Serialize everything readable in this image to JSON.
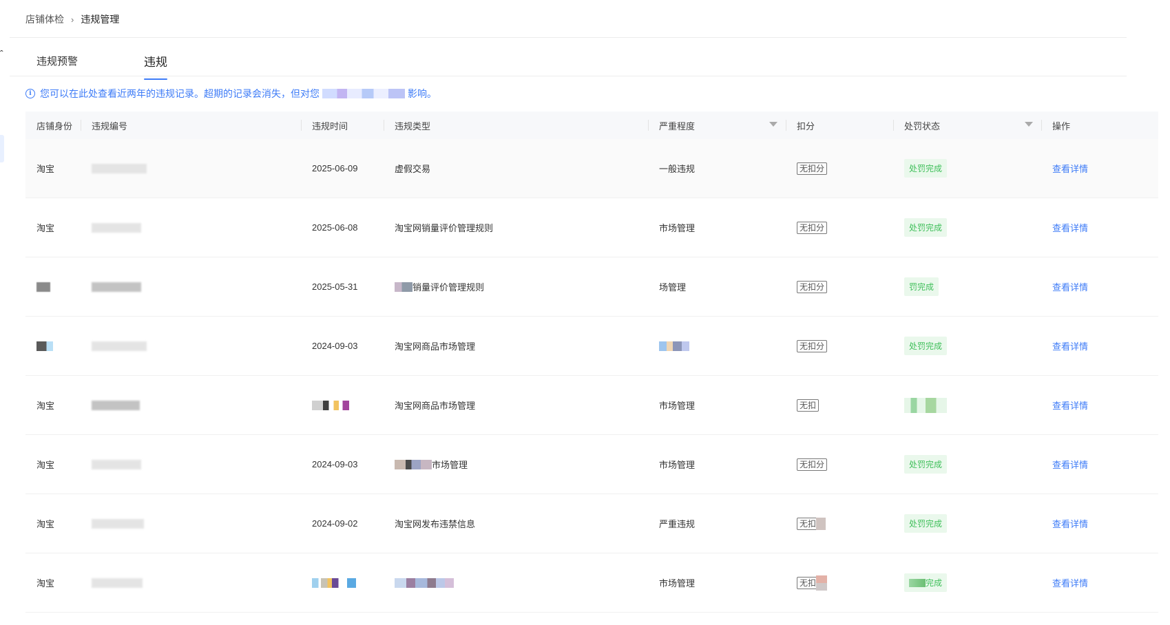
{
  "breadcrumb": {
    "parent": "店铺体检",
    "separator": "›",
    "current": "违规管理"
  },
  "tabs": [
    {
      "label": "违规预警",
      "active": false
    },
    {
      "label": "违规",
      "active": true
    }
  ],
  "notice": {
    "text_before": "您可以在此处查看近两年的违规记录。超期的记录会消失，但对您",
    "text_after": "影响。"
  },
  "table": {
    "headers": {
      "identity": "店铺身份",
      "id": "违规编号",
      "time": "违规时间",
      "type": "违规类型",
      "severity": "严重程度",
      "deduction": "扣分",
      "status": "处罚状态",
      "action": "操作"
    },
    "rows": [
      {
        "identity": "淘宝",
        "time": "2025-06-09",
        "type": "虚假交易",
        "severity": "一般违规",
        "deduction": "无扣分",
        "status": "处罚完成",
        "action": "查看详情"
      },
      {
        "identity": "淘宝",
        "time": "2025-06-08",
        "type": "淘宝网销量评价管理规则",
        "severity": "市场管理",
        "deduction": "无扣分",
        "status": "处罚完成",
        "action": "查看详情"
      },
      {
        "identity": "",
        "time": "2025-05-31",
        "type": "销量评价管理规则",
        "severity": "场管理",
        "deduction": "无扣分",
        "status": "罚完成",
        "action": "查看详情"
      },
      {
        "identity": "",
        "time": "2024-09-03",
        "type": "淘宝网商品市场管理",
        "severity": "",
        "deduction": "无扣分",
        "status": "处罚完成",
        "action": "查看详情"
      },
      {
        "identity": "淘宝",
        "time": "",
        "type": "淘宝网商品市场管理",
        "severity": "市场管理",
        "deduction": "无扣",
        "status": "",
        "action": "查看详情"
      },
      {
        "identity": "淘宝",
        "time": "2024-09-03",
        "type": "市场管理",
        "severity": "市场管理",
        "deduction": "无扣分",
        "status": "处罚完成",
        "action": "查看详情"
      },
      {
        "identity": "淘宝",
        "time": "2024-09-02",
        "type": "淘宝网发布违禁信息",
        "severity": "严重违规",
        "deduction": "无扣",
        "status": "处罚完成",
        "action": "查看详情"
      },
      {
        "identity": "淘宝",
        "time": "",
        "type": "",
        "severity": "市场管理",
        "deduction": "无扣",
        "status": "完成",
        "action": "查看详情"
      }
    ]
  },
  "icons": {
    "filter": "filter-icon",
    "info": "info-icon",
    "chevron": "chevron-right-icon"
  },
  "colors": {
    "accent": "#3d7bf7",
    "status_green": "#3fbf5a",
    "status_bg": "#eaf8ec"
  }
}
